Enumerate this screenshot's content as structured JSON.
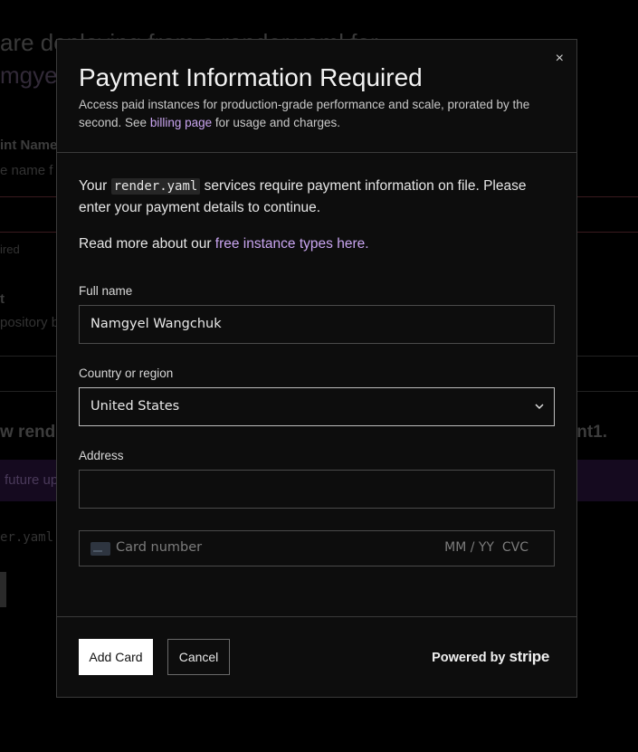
{
  "background": {
    "heading_line1": "are deploying from a render.yaml for",
    "heading_line2": "mgyel",
    "field_label": "int Name",
    "field_sub": "e name f",
    "required_note": "ired",
    "repo_label": "t",
    "repo_sub": "pository b",
    "section_heading_left": "w rend",
    "section_heading_right": "ent1.",
    "banner_text": "future up",
    "mono_text": "er.yaml t"
  },
  "modal": {
    "title": "Payment Information Required",
    "desc_before_link": "Access paid instances for production-grade performance and scale, prorated by the second. See ",
    "desc_link": "billing page",
    "desc_after_link": " for usage and charges.",
    "close_label": "×",
    "body_p1_before": "Your ",
    "body_p1_code": "render.yaml",
    "body_p1_after": " services require payment information on file. Please enter your payment details to continue.",
    "body_p2_before": "Read more about our ",
    "body_p2_link": "free instance types here.",
    "form": {
      "full_name_label": "Full name",
      "full_name_value": "Namgyel Wangchuk",
      "country_label": "Country or region",
      "country_value": "United States",
      "address_label": "Address",
      "address_value": "",
      "card_placeholder": "Card number",
      "expiry_placeholder": "MM / YY",
      "cvc_placeholder": "CVC"
    },
    "footer": {
      "add_card": "Add Card",
      "cancel": "Cancel",
      "powered_by": "Powered by",
      "brand": "stripe"
    }
  },
  "colors": {
    "link": "#c9a5f0",
    "modal_bg": "#0d0d0d",
    "border": "#3a3a3a"
  }
}
